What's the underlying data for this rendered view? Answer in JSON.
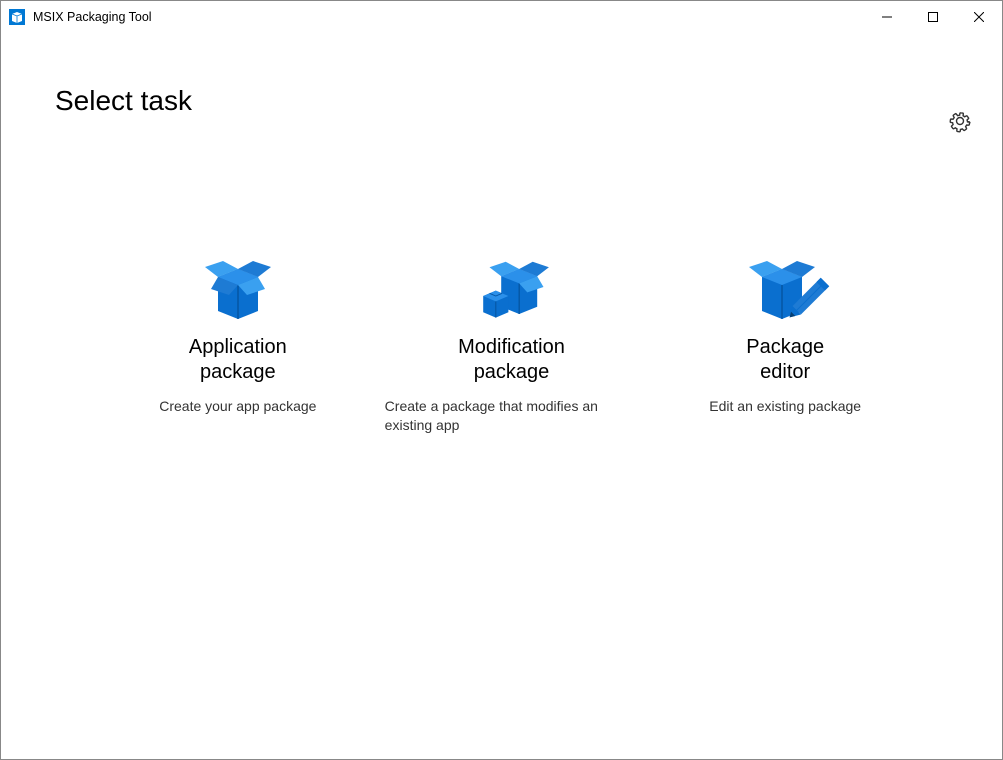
{
  "window": {
    "title": "MSIX Packaging Tool"
  },
  "page": {
    "heading": "Select task"
  },
  "tasks": {
    "application": {
      "title": "Application\npackage",
      "description": "Create your app package"
    },
    "modification": {
      "title": "Modification\npackage",
      "description": "Create a package that modifies an existing app"
    },
    "editor": {
      "title": "Package\neditor",
      "description": "Edit an existing package"
    }
  }
}
